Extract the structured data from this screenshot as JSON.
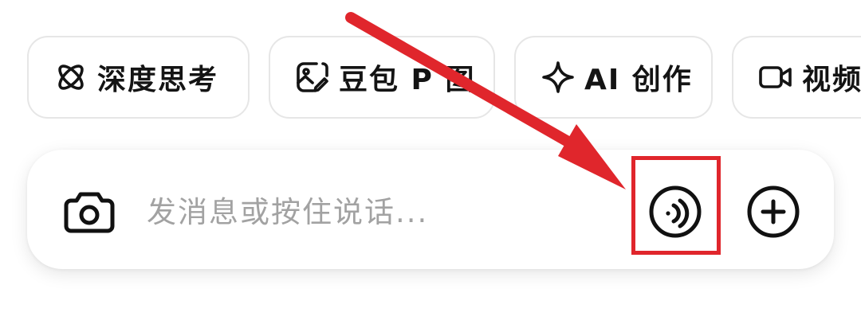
{
  "chips": [
    {
      "label": "深度思考",
      "icon": "atom-icon"
    },
    {
      "label": "豆包 P 图",
      "icon": "image-edit-icon"
    },
    {
      "label": "AI 创作",
      "icon": "sparkle-icon"
    },
    {
      "label": "视频",
      "icon": "video-camera-icon"
    }
  ],
  "input_bar": {
    "placeholder": "发消息或按住说话...",
    "camera_icon": "camera-icon",
    "voice_icon": "voice-call-icon",
    "plus_icon": "plus-circle-icon"
  },
  "annotation": {
    "color": "#e0262c",
    "target": "voice-call-button"
  }
}
